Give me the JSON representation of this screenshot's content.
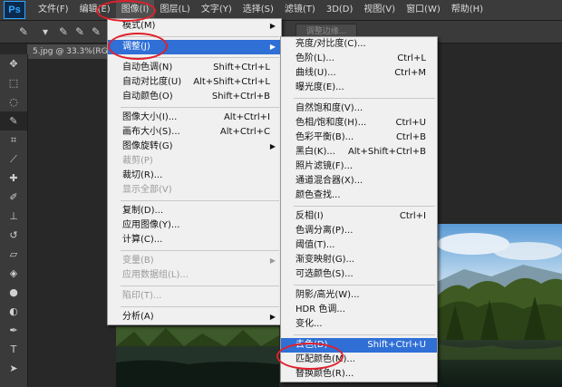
{
  "app": {
    "logo": "Ps"
  },
  "menubar": [
    "文件(F)",
    "编辑(E)",
    "图像(I)",
    "图层(L)",
    "文字(Y)",
    "选择(S)",
    "滤镜(T)",
    "3D(D)",
    "视图(V)",
    "窗口(W)",
    "帮助(H)"
  ],
  "options": {
    "refine_edge_button": "调整边缘..."
  },
  "document": {
    "tab_label": "5.jpg @ 33.3%(RGB..."
  },
  "image_menu": [
    {
      "label": "模式(M)",
      "shortcut": "",
      "submenu": true,
      "disabled": false
    },
    {
      "sep": true
    },
    {
      "label": "调整(J)",
      "shortcut": "",
      "submenu": true,
      "disabled": false,
      "highlight": true
    },
    {
      "sep": true
    },
    {
      "label": "自动色调(N)",
      "shortcut": "Shift+Ctrl+L"
    },
    {
      "label": "自动对比度(U)",
      "shortcut": "Alt+Shift+Ctrl+L"
    },
    {
      "label": "自动颜色(O)",
      "shortcut": "Shift+Ctrl+B"
    },
    {
      "sep": true
    },
    {
      "label": "图像大小(I)...",
      "shortcut": "Alt+Ctrl+I"
    },
    {
      "label": "画布大小(S)...",
      "shortcut": "Alt+Ctrl+C"
    },
    {
      "label": "图像旋转(G)",
      "shortcut": "",
      "submenu": true
    },
    {
      "label": "裁剪(P)",
      "shortcut": "",
      "disabled": true
    },
    {
      "label": "裁切(R)...",
      "shortcut": ""
    },
    {
      "label": "显示全部(V)",
      "shortcut": "",
      "disabled": true
    },
    {
      "sep": true
    },
    {
      "label": "复制(D)...",
      "shortcut": ""
    },
    {
      "label": "应用图像(Y)...",
      "shortcut": ""
    },
    {
      "label": "计算(C)...",
      "shortcut": ""
    },
    {
      "sep": true
    },
    {
      "label": "变量(B)",
      "shortcut": "",
      "submenu": true,
      "disabled": true
    },
    {
      "label": "应用数据组(L)...",
      "shortcut": "",
      "disabled": true
    },
    {
      "sep": true
    },
    {
      "label": "陷印(T)...",
      "shortcut": "",
      "disabled": true
    },
    {
      "sep": true
    },
    {
      "label": "分析(A)",
      "shortcut": "",
      "submenu": true
    }
  ],
  "adjust_menu": [
    {
      "label": "亮度/对比度(C)...",
      "shortcut": ""
    },
    {
      "label": "色阶(L)...",
      "shortcut": "Ctrl+L"
    },
    {
      "label": "曲线(U)...",
      "shortcut": "Ctrl+M"
    },
    {
      "label": "曝光度(E)...",
      "shortcut": ""
    },
    {
      "sep": true
    },
    {
      "label": "自然饱和度(V)...",
      "shortcut": ""
    },
    {
      "label": "色相/饱和度(H)...",
      "shortcut": "Ctrl+U"
    },
    {
      "label": "色彩平衡(B)...",
      "shortcut": "Ctrl+B"
    },
    {
      "label": "黑白(K)...",
      "shortcut": "Alt+Shift+Ctrl+B"
    },
    {
      "label": "照片滤镜(F)...",
      "shortcut": ""
    },
    {
      "label": "通道混合器(X)...",
      "shortcut": ""
    },
    {
      "label": "颜色查找...",
      "shortcut": ""
    },
    {
      "sep": true
    },
    {
      "label": "反相(I)",
      "shortcut": "Ctrl+I"
    },
    {
      "label": "色调分离(P)...",
      "shortcut": ""
    },
    {
      "label": "阈值(T)...",
      "shortcut": ""
    },
    {
      "label": "渐变映射(G)...",
      "shortcut": ""
    },
    {
      "label": "可选颜色(S)...",
      "shortcut": ""
    },
    {
      "sep": true
    },
    {
      "label": "阴影/高光(W)...",
      "shortcut": ""
    },
    {
      "label": "HDR 色调...",
      "shortcut": ""
    },
    {
      "label": "变化...",
      "shortcut": ""
    },
    {
      "sep": true
    },
    {
      "label": "去色(D)",
      "shortcut": "Shift+Ctrl+U",
      "highlight": true
    },
    {
      "label": "匹配颜色(M)...",
      "shortcut": ""
    },
    {
      "label": "替换颜色(R)...",
      "shortcut": ""
    }
  ]
}
